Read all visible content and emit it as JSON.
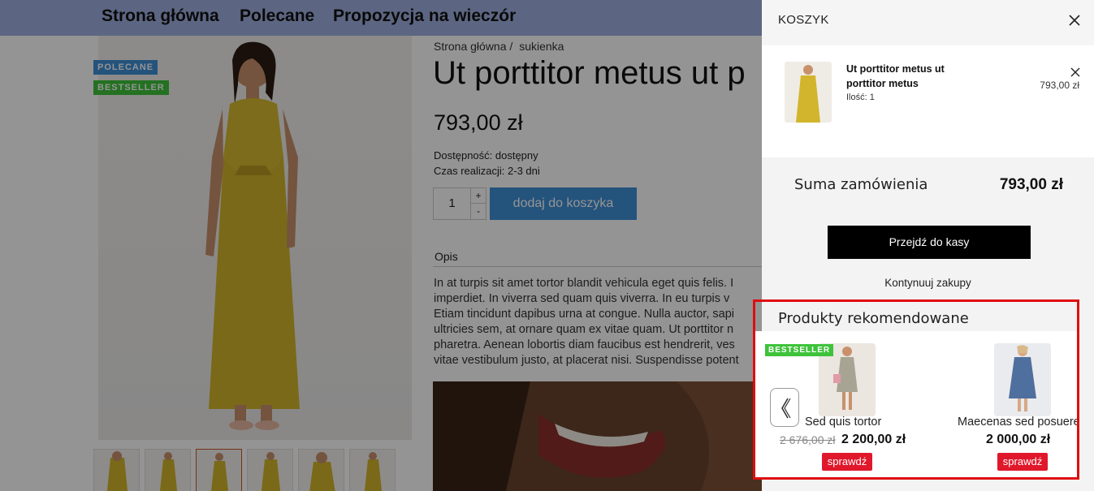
{
  "nav": {
    "items": [
      "Strona główna",
      "Polecane",
      "Propozycja na wieczór"
    ]
  },
  "product": {
    "badges": [
      "POLECANE",
      "BESTSELLER"
    ],
    "breadcrumb": [
      "Strona główna /",
      "sukienka"
    ],
    "title": "Ut porttitor metus ut p",
    "price": "793,00 zł",
    "availability": "Dostępność: dostępny",
    "lead_time": "Czas realizacji: 2-3 dni",
    "quantity": "1",
    "qty_plus": "+",
    "qty_minus": "-",
    "add_to_cart": "dodaj do koszyka",
    "description_tab": "Opis",
    "description": "In at turpis sit amet tortor blandit vehicula eget quis felis. I\nimperdiet. In viverra sed quam quis viverra. In eu turpis v\nEtiam tincidunt dapibus urna at congue. Nulla auctor, sapi\nultricies sem, at ornare quam ex vitae quam. Ut porttitor n\npharetra. Aenean lobortis diam faucibus est hendrerit, ves\nvitae vestibulum justo, at placerat nisi. Suspendisse potent"
  },
  "cart": {
    "title": "KOSZYK",
    "item": {
      "name": "Ut porttitor metus ut porttitor metus",
      "qty": "Ilość: 1",
      "price": "793,00 zł"
    },
    "sum_label": "Suma zamówienia",
    "sum_value": "793,00 zł",
    "checkout": "Przejdź do kasy",
    "continue": "Kontynuuj zakupy"
  },
  "recommended": {
    "title": "Produkty rekomendowane",
    "badge": "BESTSELLER",
    "products": [
      {
        "name": "Sed quis tortor",
        "old_price": "2 676,00 zł",
        "price": "2 200,00 zł",
        "button": "sprawdź"
      },
      {
        "name": "Maecenas sed posuere",
        "price": "2 000,00 zł",
        "button": "sprawdź"
      }
    ]
  },
  "colors": {
    "nav_bg": "#9fb0e0",
    "accent_blue": "#3f8fd6",
    "bestseller_green": "#3ec33b",
    "highlight_red": "#e00d0d",
    "button_red": "#e0182c"
  }
}
